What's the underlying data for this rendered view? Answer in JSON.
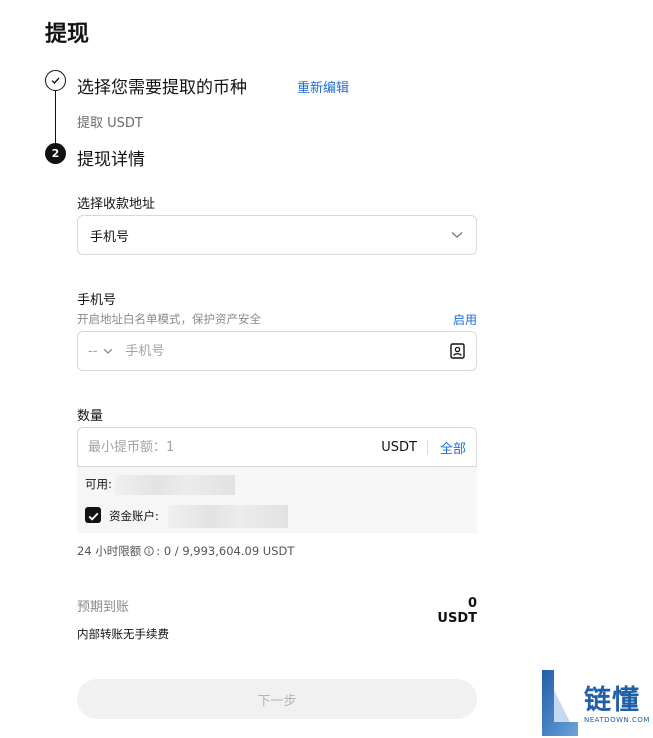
{
  "page": {
    "title": "提现"
  },
  "steps": [
    {
      "number": "",
      "title": "选择您需要提取的币种",
      "action": "重新编辑",
      "subtitle": "提取 USDT",
      "status": "done"
    },
    {
      "number": "2",
      "title": "提现详情",
      "status": "active"
    }
  ],
  "address": {
    "label": "选择收款地址",
    "selected": "手机号"
  },
  "phone": {
    "label": "手机号",
    "hint": "开启地址白名单模式，保护资产安全",
    "enable_link": "启用",
    "country_code": "--",
    "placeholder": "手机号"
  },
  "quantity": {
    "label": "数量",
    "placeholder": "最小提币额：1",
    "unit": "USDT",
    "all_link": "全部"
  },
  "balance": {
    "available_label": "可用:",
    "fund_account_label": "资金账户:",
    "fund_account_checked": true
  },
  "limit": {
    "label": "24 小时限额",
    "value": ": 0 / 9,993,604.09 USDT"
  },
  "expected": {
    "label": "预期到账",
    "value": "0 USDT"
  },
  "fee_note": "内部转账无手续费",
  "next_button": "下一步",
  "watermark": {
    "text": "链懂",
    "domain": "NEATDOWN.COM"
  },
  "colors": {
    "accent": "#1a6fd9",
    "primary": "#121212",
    "muted": "#8a8a8a",
    "watermark": "#1f5fa8"
  },
  "icons": {
    "step_done": "check-icon",
    "address_chevron": "chevron-down-icon",
    "contact": "contact-book-icon",
    "info": "info-icon"
  }
}
